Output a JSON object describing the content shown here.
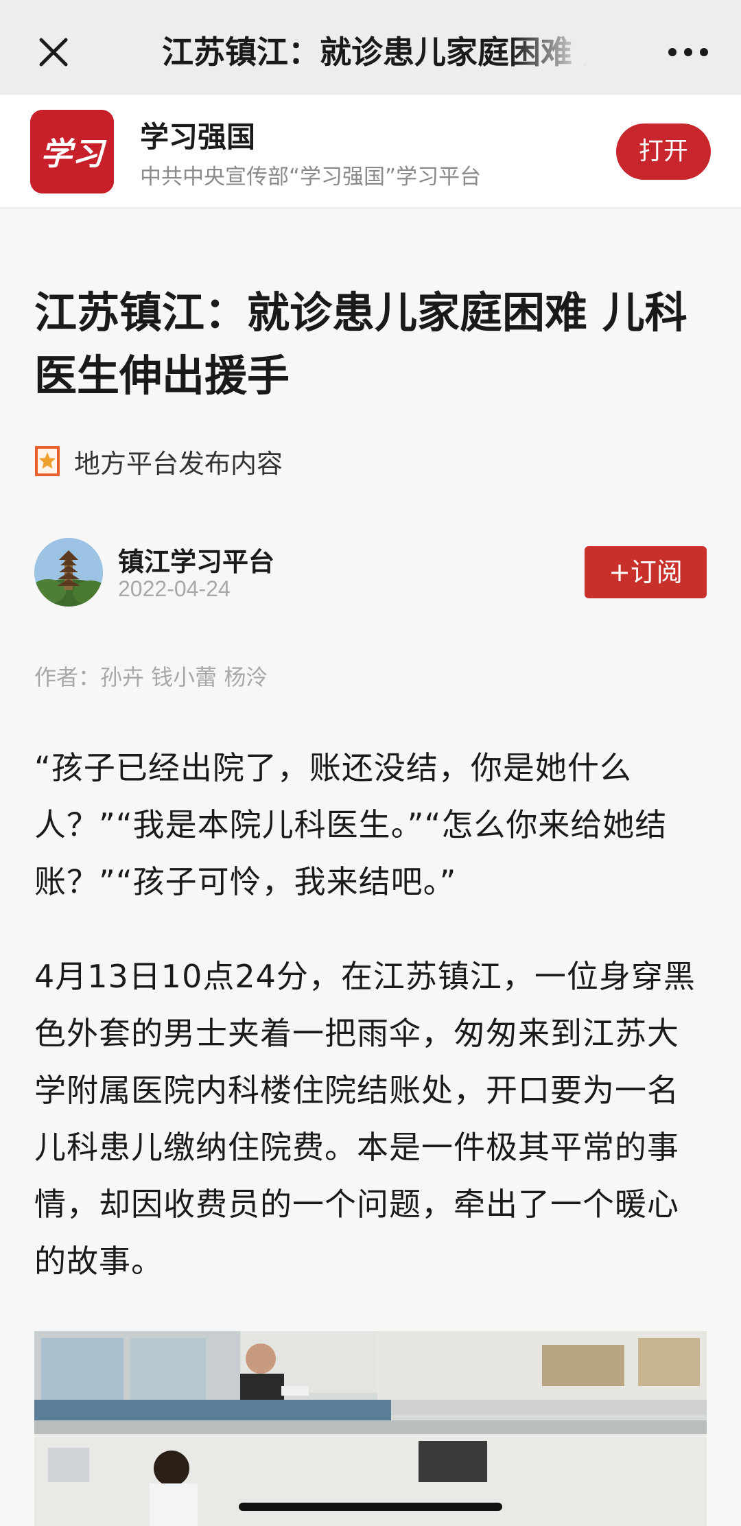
{
  "topbar": {
    "title": "江苏镇江：就诊患儿家庭困难 儿科医生伸出援手",
    "close_icon": "close-icon",
    "more_icon": "more-icon"
  },
  "banner": {
    "app_name": "学习强国",
    "app_desc": "中共中央宣传部“学习强国”学习平台",
    "logo_text": "学习",
    "open_label": "打开",
    "brand_color": "#c7262c"
  },
  "article": {
    "title": "江苏镇江：就诊患儿家庭困难 儿科医生伸出援手",
    "source_tag": "地方平台发布内容",
    "publisher": "镇江学习平台",
    "date": "2022-04-24",
    "subscribe_label": "+订阅",
    "byline": "作者：孙卉 钱小蕾 杨泠",
    "paragraphs": [
      "“孩子已经出院了，账还没结，你是她什么人？”“我是本院儿科医生。”“怎么你来给她结账？”“孩子可怜，我来结吧。”",
      "4月13日10点24分，在江苏镇江，一位身穿黑色外套的男士夹着一把雨伞，匆匆来到江苏大学附属医院内科楼住院结账处，开口要为一名儿科患儿缴纳住院费。本是一件极其平常的事情，却因收费员的一个问题，牵出了一个暖心的故事。"
    ]
  }
}
